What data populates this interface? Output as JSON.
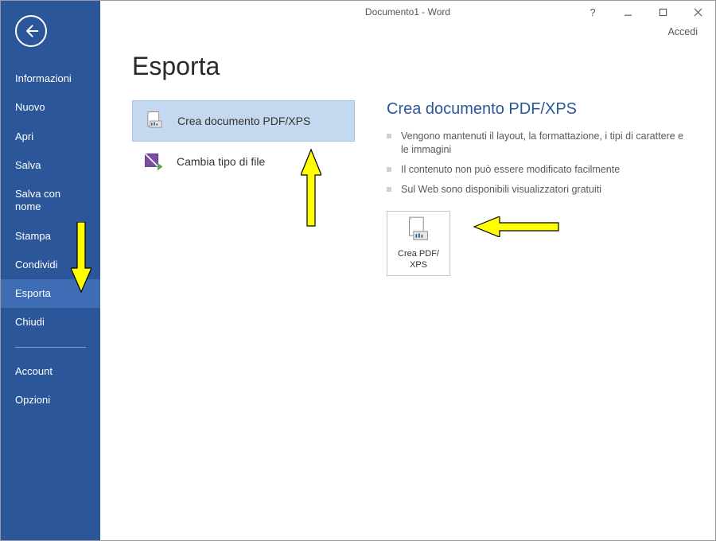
{
  "window": {
    "title": "Documento1 - Word",
    "signin": "Accedi"
  },
  "sidebar": {
    "items": [
      {
        "label": "Informazioni"
      },
      {
        "label": "Nuovo"
      },
      {
        "label": "Apri"
      },
      {
        "label": "Salva"
      },
      {
        "label": "Salva con nome"
      },
      {
        "label": "Stampa"
      },
      {
        "label": "Condividi"
      },
      {
        "label": "Esporta"
      },
      {
        "label": "Chiudi"
      },
      {
        "label": "Account"
      },
      {
        "label": "Opzioni"
      }
    ],
    "selected_index": 7
  },
  "page": {
    "title": "Esporta",
    "options": [
      {
        "label": "Crea documento PDF/XPS"
      },
      {
        "label": "Cambia tipo di file"
      }
    ],
    "selected_option": 0,
    "detail": {
      "title": "Crea documento PDF/XPS",
      "bullets": [
        "Vengono mantenuti il layout, la formattazione, i tipi di carattere e le immagini",
        "Il contenuto non può essere modificato facilmente",
        "Sul Web sono disponibili visualizzatori gratuiti"
      ],
      "button_label": "Crea PDF/\nXPS"
    }
  },
  "colors": {
    "accent": "#2b579a",
    "selected_bg": "#c4d8ef",
    "arrow_fill": "#ffff00",
    "arrow_stroke": "#000000"
  }
}
